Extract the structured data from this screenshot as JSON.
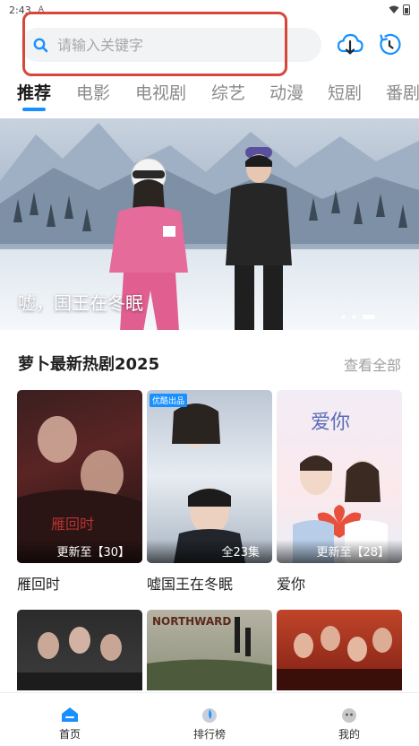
{
  "status_bar": {
    "time": "2:43",
    "notification_glyph": "A"
  },
  "search": {
    "placeholder": "请输入关键字",
    "value": ""
  },
  "toolbar": {
    "cloud_icon": "cloud-download-icon",
    "history_icon": "history-clock-icon"
  },
  "tabs": [
    {
      "label": "推荐",
      "active": true
    },
    {
      "label": "电影",
      "active": false
    },
    {
      "label": "电视剧",
      "active": false
    },
    {
      "label": "综艺",
      "active": false
    },
    {
      "label": "动漫",
      "active": false
    },
    {
      "label": "短剧",
      "active": false
    },
    {
      "label": "番剧",
      "active": false
    }
  ],
  "banner": {
    "title": "嘘，国王在冬眠",
    "slide_count": 3,
    "active_slide": 3
  },
  "section": {
    "title": "萝卜最新热剧2025",
    "see_all": "查看全部",
    "cards": [
      {
        "title": "雁回时",
        "badge": "更新至【30】",
        "poster_text": "雁回时"
      },
      {
        "title": "嘘国王在冬眠",
        "badge": "全23集",
        "tag": "优酷出品"
      },
      {
        "title": "爱你",
        "badge": "更新至【28】",
        "poster_text": "爱你"
      }
    ],
    "row2_posters": [
      {
        "text": ""
      },
      {
        "text": "NORTHWARD"
      },
      {
        "text": ""
      }
    ]
  },
  "bottom_nav": [
    {
      "label": "首页",
      "active": true
    },
    {
      "label": "排行榜",
      "active": false
    },
    {
      "label": "我的",
      "active": false
    }
  ],
  "colors": {
    "accent": "#1890ff",
    "highlight_border": "#d6473a"
  }
}
